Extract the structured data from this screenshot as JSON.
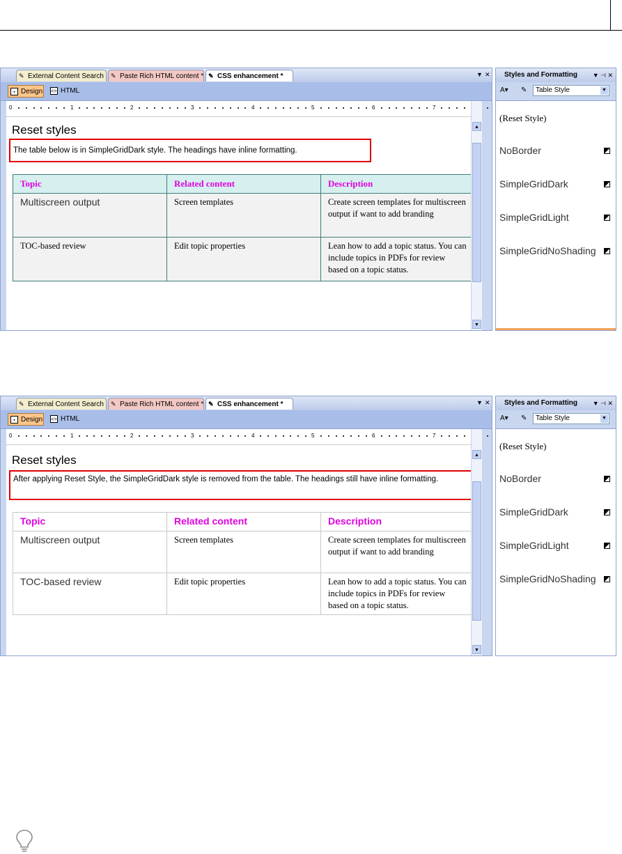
{
  "shots": [
    {
      "tabs": [
        "External Content Search",
        "Paste Rich HTML content *",
        "CSS enhancement *"
      ],
      "views": [
        "Design",
        "HTML"
      ],
      "ruler": [
        "0",
        "1",
        "2",
        "3",
        "4",
        "5",
        "6",
        "7"
      ],
      "heading": "Reset styles",
      "note": "The table below is in SimpleGridDark style. The headings have inline formatting.",
      "table": {
        "headers": [
          "Topic",
          "Related content",
          "Description"
        ],
        "rows": [
          [
            "Multiscreen output",
            "Screen templates",
            "Create screen templates for multiscreen output if want to add branding"
          ],
          [
            "TOC-based review",
            "Edit topic properties",
            "Lean how to add a topic status. You can include topics in PDFs for review based on a topic status."
          ]
        ]
      },
      "panel": {
        "title": "Styles and Formatting",
        "dropdown": "Table Style",
        "items": [
          "(Reset Style)",
          "NoBorder",
          "SimpleGridDark",
          "SimpleGridLight",
          "SimpleGridNoShading"
        ]
      }
    },
    {
      "tabs": [
        "External Content Search",
        "Paste Rich HTML content *",
        "CSS enhancement *"
      ],
      "views": [
        "Design",
        "HTML"
      ],
      "ruler": [
        "0",
        "1",
        "2",
        "3",
        "4",
        "5",
        "6",
        "7"
      ],
      "heading": "Reset styles",
      "note": "After applying Reset Style, the SimpleGridDark style is removed from the table. The headings still have inline formatting.",
      "table": {
        "headers": [
          "Topic",
          "Related content",
          "Description"
        ],
        "rows": [
          [
            "Multiscreen output",
            "Screen templates",
            "Create screen templates for multiscreen output if want to add branding"
          ],
          [
            "TOC-based review",
            "Edit topic properties",
            "Lean how to add a topic status. You can include topics in PDFs for review based on a topic status."
          ]
        ]
      },
      "panel": {
        "title": "Styles and Formatting",
        "dropdown": "Table Style",
        "items": [
          "(Reset Style)",
          "NoBorder",
          "SimpleGridDark",
          "SimpleGridLight",
          "SimpleGridNoShading"
        ]
      }
    }
  ]
}
